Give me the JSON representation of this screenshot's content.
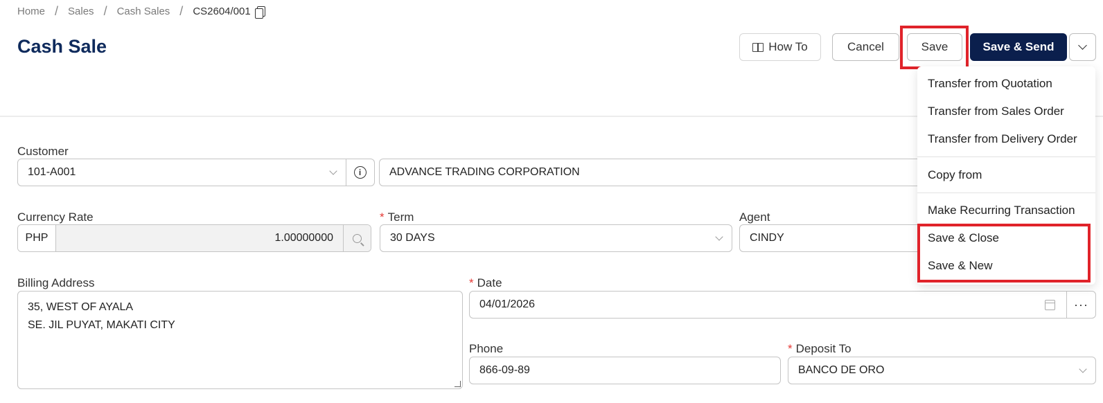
{
  "breadcrumb": {
    "items": [
      "Home",
      "Sales",
      "Cash Sales"
    ],
    "current": "CS2604/001"
  },
  "page": {
    "title": "Cash Sale"
  },
  "toolbar": {
    "how_to": "How To",
    "cancel": "Cancel",
    "save": "Save",
    "save_send": "Save & Send"
  },
  "dropdown": {
    "items": [
      "Transfer from Quotation",
      "Transfer from Sales Order",
      "Transfer from Delivery Order",
      "Copy from",
      "Make Recurring Transaction",
      "Save & Close",
      "Save & New"
    ]
  },
  "form": {
    "customer": {
      "label": "Customer",
      "code": "101-A001",
      "name": "ADVANCE TRADING CORPORATION"
    },
    "currency": {
      "label": "Currency Rate",
      "code": "PHP",
      "rate": "1.00000000"
    },
    "term": {
      "label": "Term",
      "value": "30 DAYS"
    },
    "agent": {
      "label": "Agent",
      "value": "CINDY"
    },
    "billing": {
      "label": "Billing Address",
      "line1": "35, WEST OF AYALA",
      "line2": "SE. JIL PUYAT, MAKATI CITY"
    },
    "date": {
      "label": "Date",
      "value": "04/01/2026"
    },
    "phone": {
      "label": "Phone",
      "value": "866-09-89"
    },
    "deposit": {
      "label": "Deposit To",
      "value": "BANCO DE ORO"
    }
  },
  "colors": {
    "title": "#0e2a5c",
    "primary_button": "#0b1f4d",
    "highlight": "#e0232a",
    "required": "#e53935"
  },
  "icons": [
    "copy-icon",
    "book-icon",
    "chevron-down-icon",
    "info-icon",
    "search-icon",
    "calendar-icon",
    "ellipsis-icon"
  ]
}
